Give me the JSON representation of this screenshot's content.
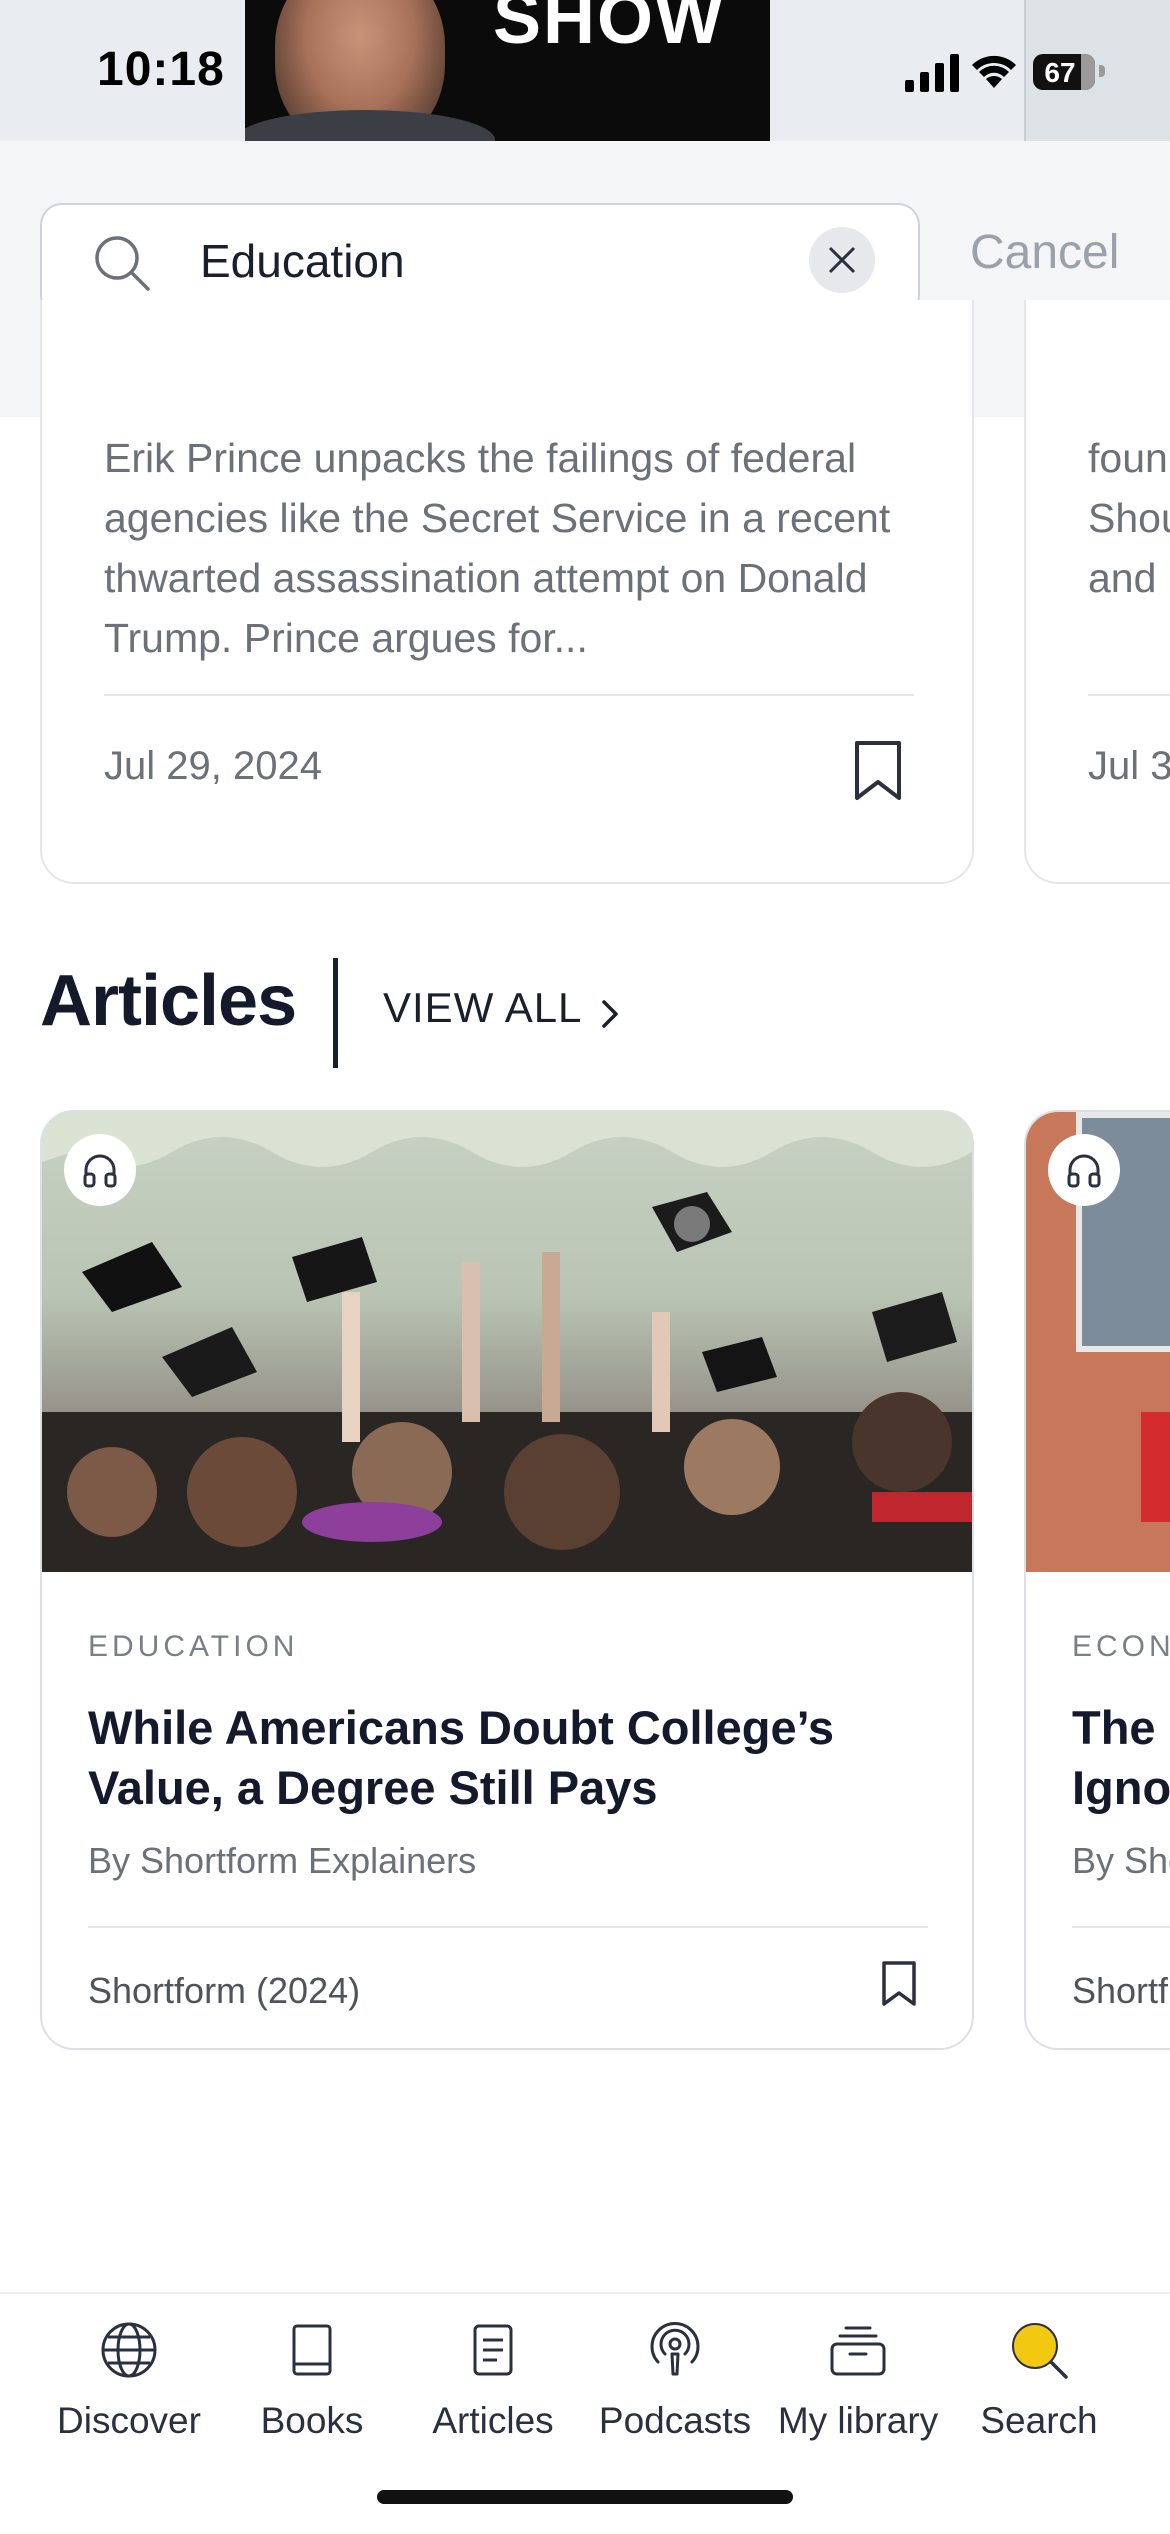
{
  "status_bar": {
    "time": "10:18",
    "battery": "67",
    "battery_level": 67,
    "video_overlay_text": "SHOW"
  },
  "search": {
    "value": "Education",
    "clear_icon": "close-icon",
    "cancel_label": "Cancel"
  },
  "podcast_cards": [
    {
      "description": "Erik Prince unpacks the failings of federal agencies like the Secret Service in a recent thwarted assassination attempt on Donald Trump. Prince argues for...",
      "date": "Jul 29, 2024"
    },
    {
      "description_lines": [
        "foun",
        "Shou",
        "and"
      ],
      "date": "Jul 3"
    }
  ],
  "articles_section": {
    "title": "Articles",
    "view_all": "VIEW ALL"
  },
  "article_cards": [
    {
      "category": "EDUCATION",
      "title": "While Americans Doubt College’s Value, a Degree Still Pays",
      "author": "By Shortform Explainers",
      "source": "Shortform (2024)"
    },
    {
      "category": "ECON",
      "title_lines": [
        "The ",
        "Igno"
      ],
      "author": "By Sho",
      "source": "Shortf"
    }
  ],
  "tab_bar": {
    "tabs": [
      {
        "label": "Discover",
        "icon": "globe-icon"
      },
      {
        "label": "Books",
        "icon": "book-icon"
      },
      {
        "label": "Articles",
        "icon": "article-icon"
      },
      {
        "label": "Podcasts",
        "icon": "podcast-icon"
      },
      {
        "label": "My library",
        "icon": "library-icon"
      },
      {
        "label": "Search",
        "icon": "search-icon",
        "active": true
      }
    ],
    "active_color": "#f2c811"
  }
}
